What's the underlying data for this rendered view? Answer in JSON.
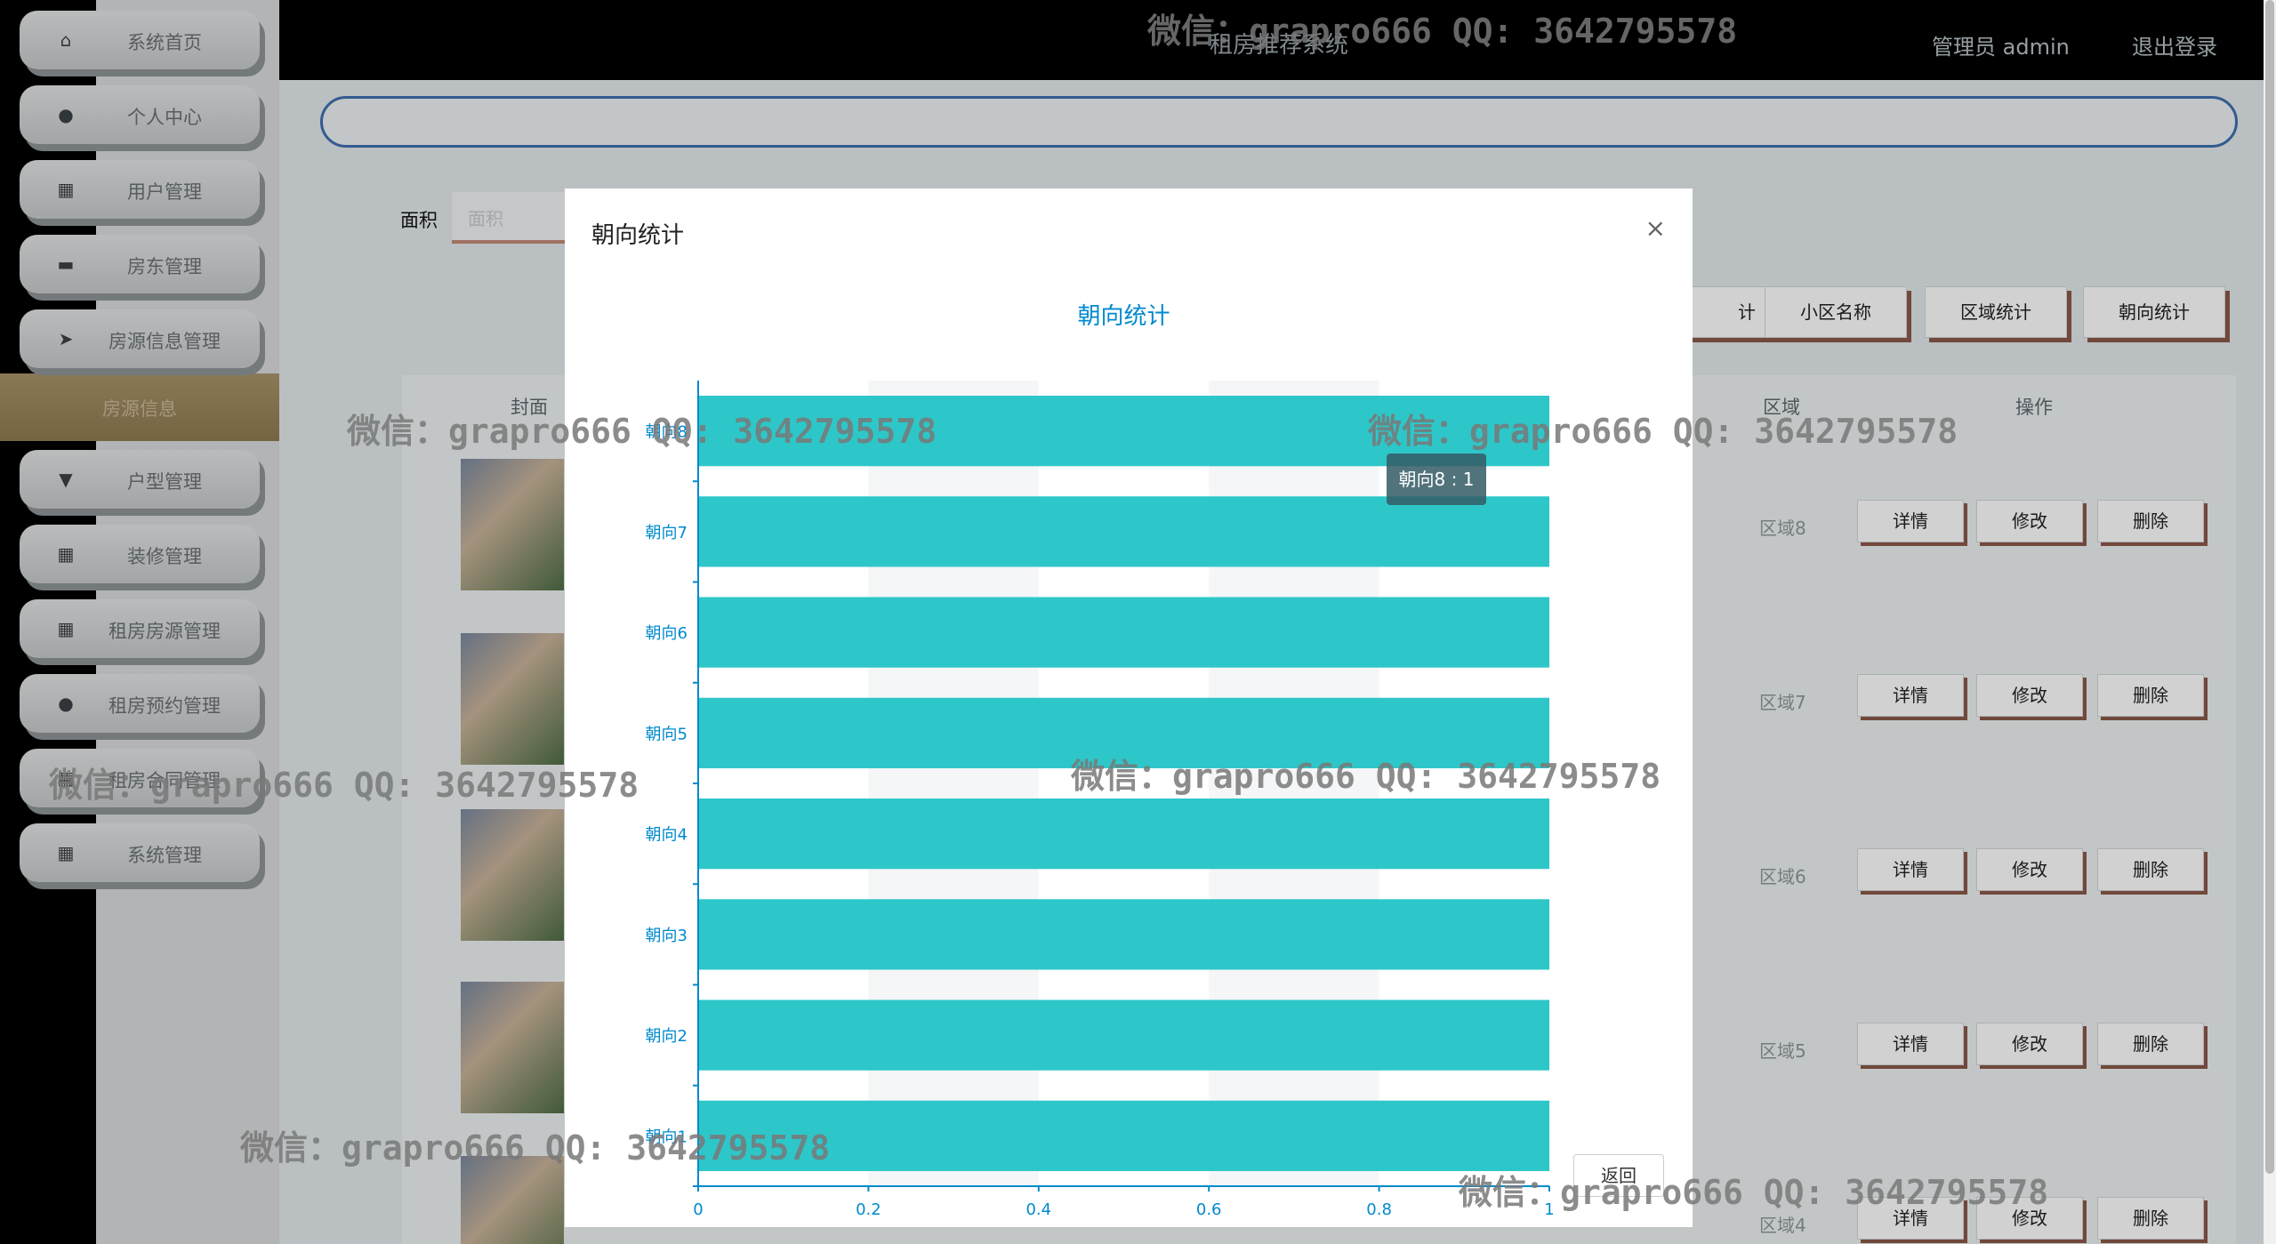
{
  "header": {
    "system_title": "租房推荐系统",
    "admin_label": "管理员 admin",
    "logout": "退出登录"
  },
  "sidebar": {
    "items": [
      {
        "label": "系统首页",
        "icon": "home-icon",
        "glyph": "⌂"
      },
      {
        "label": "个人中心",
        "icon": "user-icon",
        "glyph": "●"
      },
      {
        "label": "用户管理",
        "icon": "grid-icon",
        "glyph": "▦"
      },
      {
        "label": "房东管理",
        "icon": "briefcase-icon",
        "glyph": "▬"
      },
      {
        "label": "房源信息管理",
        "icon": "send-icon",
        "glyph": "➤"
      },
      {
        "label": "户型管理",
        "icon": "brush-icon",
        "glyph": "▼"
      },
      {
        "label": "装修管理",
        "icon": "grid-icon",
        "glyph": "▦"
      },
      {
        "label": "租房房源管理",
        "icon": "grid-icon",
        "glyph": "▦"
      },
      {
        "label": "租房预约管理",
        "icon": "user-icon",
        "glyph": "●"
      },
      {
        "label": "租房合同管理",
        "icon": "grid-icon",
        "glyph": "▦"
      },
      {
        "label": "系统管理",
        "icon": "grid-icon",
        "glyph": "▦"
      }
    ],
    "active_sub": "房源信息"
  },
  "main": {
    "filter_label": "面积",
    "filter_placeholder": "面积",
    "top_buttons": [
      "计",
      "小区名称",
      "区域统计",
      "朝向统计"
    ],
    "table_headers": {
      "cover": "封面",
      "area_region": "区域",
      "actions": "操作"
    },
    "rows": [
      {
        "region": "区域8"
      },
      {
        "region": "区域7"
      },
      {
        "region": "区域6"
      },
      {
        "region": "区域5"
      },
      {
        "region": "区域4"
      }
    ],
    "row_buttons": {
      "detail": "详情",
      "edit": "修改",
      "delete": "删除"
    }
  },
  "modal": {
    "title": "朝向统计",
    "close": "×",
    "back": "返回",
    "tooltip": "朝向8 : 1"
  },
  "chart_data": {
    "type": "bar",
    "orientation": "horizontal",
    "title": "朝向统计",
    "categories": [
      "朝向1",
      "朝向2",
      "朝向3",
      "朝向4",
      "朝向5",
      "朝向6",
      "朝向7",
      "朝向8"
    ],
    "values": [
      1,
      1,
      1,
      1,
      1,
      1,
      1,
      1
    ],
    "xlim": [
      0,
      1
    ],
    "xticks": [
      "0",
      "0.2",
      "0.4",
      "0.6",
      "0.8",
      "1"
    ],
    "bar_color": "#2ec7c9",
    "axis_color": "#008acd"
  },
  "watermark": "微信：grapro666 QQ: 3642795578"
}
